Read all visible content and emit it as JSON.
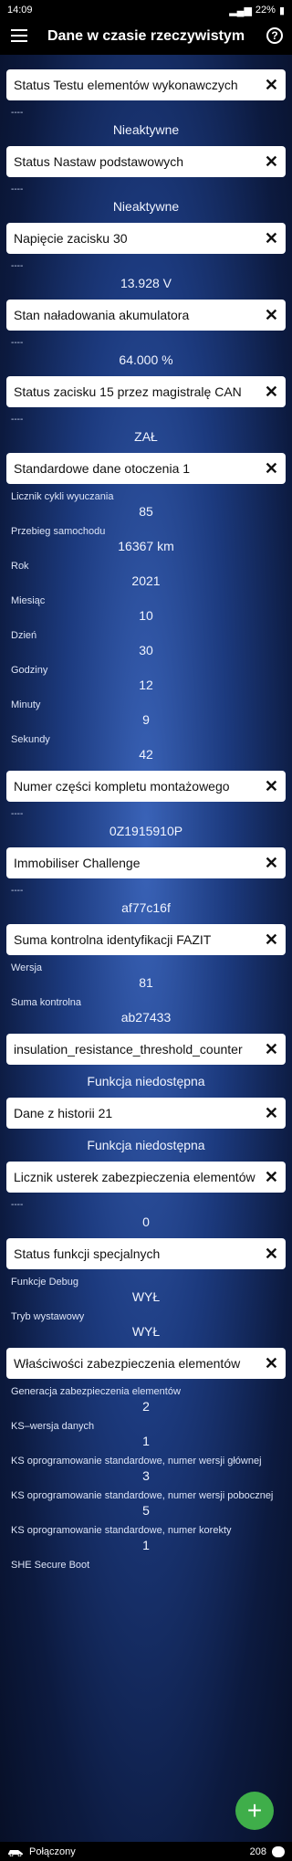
{
  "status_bar": {
    "time": "14:09",
    "battery": "22%"
  },
  "app_bar": {
    "title": "Dane w czasie rzeczywistym",
    "help": "?"
  },
  "cards": {
    "c1": {
      "title": "Status Testu elementów wykonawczych",
      "dashes": "----",
      "value": "Nieaktywne"
    },
    "c2": {
      "title": "Status Nastaw podstawowych",
      "dashes": "----",
      "value": "Nieaktywne"
    },
    "c3": {
      "title": "Napięcie zacisku 30",
      "dashes": "----",
      "value": "13.928 V"
    },
    "c4": {
      "title": "Stan naładowania akumulatora",
      "dashes": "----",
      "value": "64.000 %"
    },
    "c5": {
      "title": "Status zacisku 15 przez magistralę CAN",
      "dashes": "----",
      "value": "ZAŁ"
    },
    "c6": {
      "title": "Standardowe dane otoczenia 1",
      "rows": {
        "r1": {
          "label": "Licznik cykli wyuczania",
          "value": "85"
        },
        "r2": {
          "label": "Przebieg samochodu",
          "value": "16367 km"
        },
        "r3": {
          "label": "Rok",
          "value": "2021"
        },
        "r4": {
          "label": "Miesiąc",
          "value": "10"
        },
        "r5": {
          "label": "Dzień",
          "value": "30"
        },
        "r6": {
          "label": "Godziny",
          "value": "12"
        },
        "r7": {
          "label": "Minuty",
          "value": "9"
        },
        "r8": {
          "label": "Sekundy",
          "value": "42"
        }
      }
    },
    "c7": {
      "title": "Numer części kompletu montażowego",
      "dashes": "----",
      "value": "0Z1915910P"
    },
    "c8": {
      "title": "Immobiliser Challenge",
      "dashes": "----",
      "value": "af77c16f"
    },
    "c9": {
      "title": "Suma kontrolna identyfikacji FAZIT",
      "rows": {
        "r1": {
          "label": "Wersja",
          "value": "81"
        },
        "r2": {
          "label": "Suma kontrolna",
          "value": "ab27433"
        }
      }
    },
    "c10": {
      "title": "insulation_resistance_threshold_counter",
      "value": "Funkcja niedostępna"
    },
    "c11": {
      "title": "Dane z historii 21",
      "value": "Funkcja niedostępna"
    },
    "c12": {
      "title": "Licznik usterek zabezpieczenia elementów",
      "dashes": "----",
      "value": "0"
    },
    "c13": {
      "title": "Status funkcji specjalnych",
      "rows": {
        "r1": {
          "label": "Funkcje Debug",
          "value": "WYŁ"
        },
        "r2": {
          "label": "Tryb wystawowy",
          "value": "WYŁ"
        }
      }
    },
    "c14": {
      "title": "Właściwości zabezpieczenia elementów",
      "rows": {
        "r1": {
          "label": "Generacja zabezpieczenia elementów",
          "value": "2"
        },
        "r2": {
          "label": "KS–wersja danych",
          "value": "1"
        },
        "r3": {
          "label": "KS oprogramowanie standardowe, numer wersji głównej",
          "value": "3"
        },
        "r4": {
          "label": "KS oprogramowanie standardowe, numer wersji pobocznej",
          "value": "5"
        },
        "r5": {
          "label": "KS oprogramowanie standardowe, numer korekty",
          "value": "1"
        },
        "r6": {
          "label": "SHE Secure Boot",
          "value": ""
        }
      }
    }
  },
  "bottom_bar": {
    "status": "Połączony",
    "count": "208"
  },
  "fab": {
    "symbol": "+"
  }
}
